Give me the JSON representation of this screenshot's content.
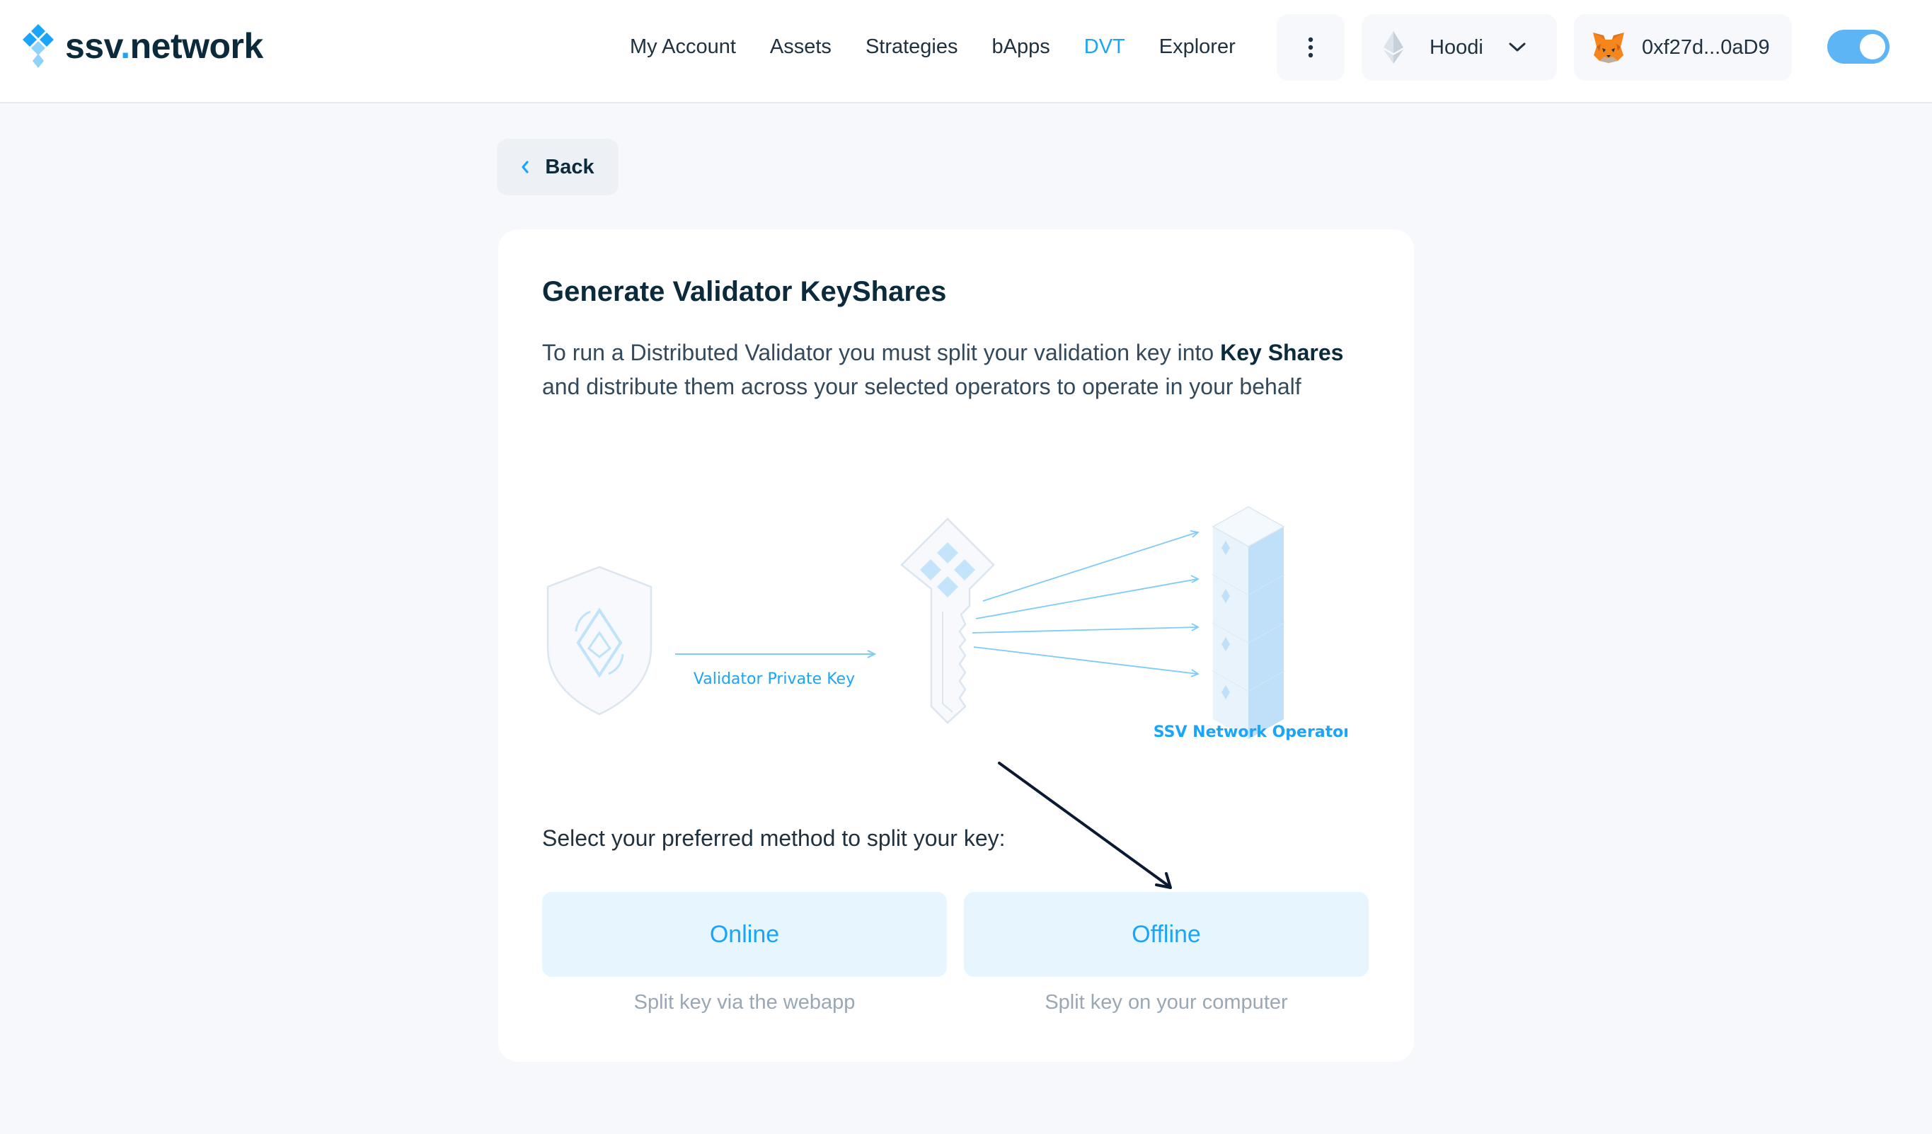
{
  "header": {
    "logo": {
      "name": "ssv",
      "dot": ".",
      "suffix": "network"
    },
    "nav": [
      "My Account",
      "Assets",
      "Strategies",
      "bApps",
      "DVT",
      "Explorer"
    ],
    "active_nav": "DVT",
    "network": "Hoodi",
    "wallet_address": "0xf27d...0aD9"
  },
  "back_label": "Back",
  "card": {
    "title": "Generate Validator KeyShares",
    "desc_part1": "To run a Distributed Validator you must split your validation key into ",
    "desc_bold": "Key Shares",
    "desc_part2": " and distribute them across your selected operators to operate in your behalf",
    "illustration": {
      "arrow_label": "Validator Private Key",
      "operators_label": "SSV Network Operators"
    },
    "select_label": "Select your preferred method to split your key:",
    "methods": [
      {
        "label": "Online",
        "sub": "Split key via the webapp"
      },
      {
        "label": "Offline",
        "sub": "Split key on your computer"
      }
    ]
  },
  "colors": {
    "accent": "#1BA5F8",
    "background": "#F6F8FB",
    "method_bg": "#E7F6FE",
    "text_dark": "#0B2A3C"
  }
}
